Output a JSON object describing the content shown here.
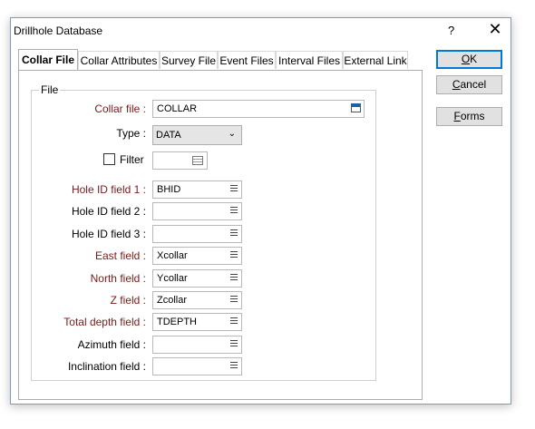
{
  "window": {
    "title": "Drillhole Database",
    "help_glyph": "?",
    "close_glyph": "✕"
  },
  "tabs": [
    {
      "label": "Collar File",
      "active": true
    },
    {
      "label": "Collar Attributes"
    },
    {
      "label": "Survey File"
    },
    {
      "label": "Event Files"
    },
    {
      "label": "Interval Files"
    },
    {
      "label": "External Link"
    }
  ],
  "group": {
    "legend": "File"
  },
  "form": {
    "collar_file": {
      "label": "Collar file :",
      "value": "COLLAR"
    },
    "type": {
      "label": "Type :",
      "value": "DATA"
    },
    "filter": {
      "label": "Filter",
      "checked": false,
      "value": ""
    },
    "fields": [
      {
        "label": "Hole ID field 1 :",
        "value": "BHID",
        "required": true
      },
      {
        "label": "Hole ID field 2 :",
        "value": "",
        "required": false
      },
      {
        "label": "Hole ID field 3 :",
        "value": "",
        "required": false
      },
      {
        "label": "East field :",
        "value": "Xcollar",
        "required": true
      },
      {
        "label": "North field :",
        "value": "Ycollar",
        "required": true
      },
      {
        "label": "Z field :",
        "value": "Zcollar",
        "required": true
      },
      {
        "label": "Total depth field :",
        "value": "TDEPTH",
        "required": true
      },
      {
        "label": "Azimuth field :",
        "value": "",
        "required": false
      },
      {
        "label": "Inclination field :",
        "value": "",
        "required": false
      }
    ]
  },
  "buttons": {
    "ok": {
      "mnemonic": "O",
      "rest": "K"
    },
    "cancel": {
      "mnemonic": "C",
      "rest": "ancel"
    },
    "forms": {
      "mnemonic": "F",
      "rest": "orms"
    }
  },
  "colors": {
    "required_label": "#7a1a1a",
    "default_button_border": "#0078d7"
  }
}
